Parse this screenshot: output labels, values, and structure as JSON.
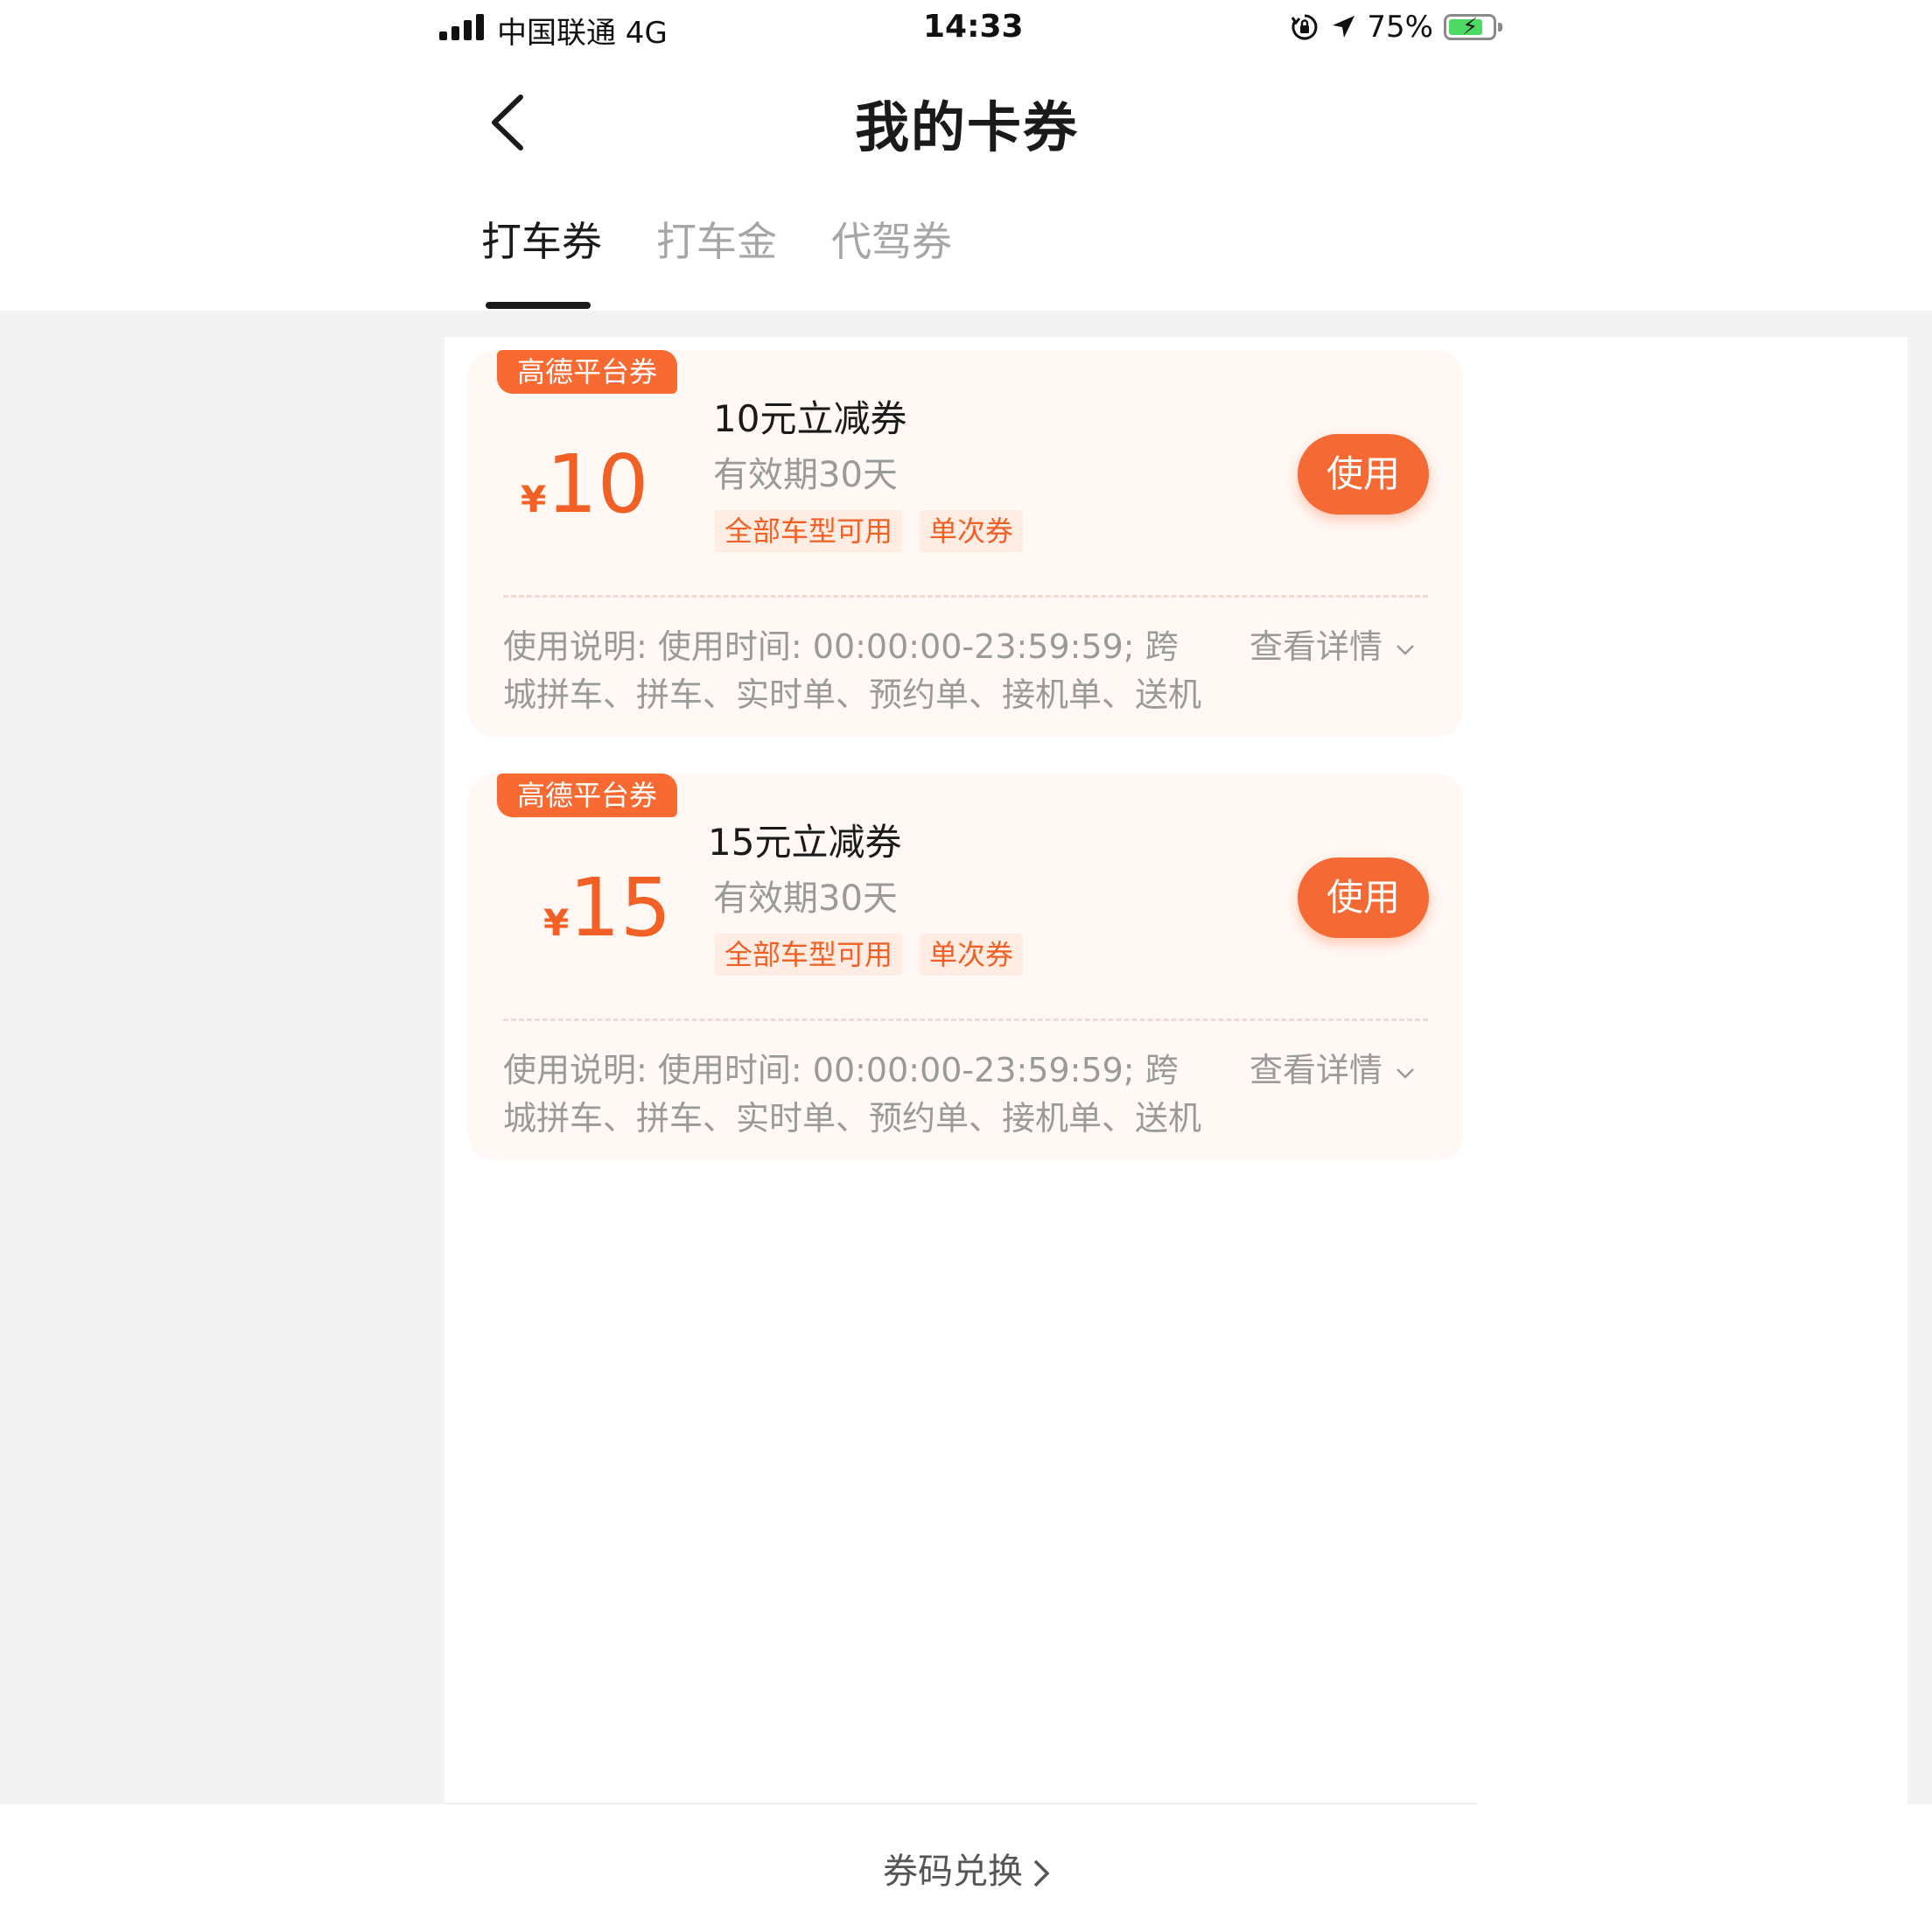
{
  "status_bar": {
    "carrier": "中国联通  4G",
    "time": "14:33",
    "battery": "75%",
    "icons": [
      "signal-icon",
      "rotation-lock-icon",
      "location-arrow-icon",
      "battery-charging-icon"
    ]
  },
  "header": {
    "title": "我的卡券",
    "back_icon": "chevron-left-icon"
  },
  "tabs": [
    {
      "label": "打车券",
      "active": true
    },
    {
      "label": "打车金",
      "active": false
    },
    {
      "label": "代驾券",
      "active": false
    }
  ],
  "coupons": [
    {
      "badge": "高德平台券",
      "currency": "¥",
      "amount": "10",
      "title": "10元立减券",
      "validity": "有效期30天",
      "tags": [
        "全部车型可用",
        "单次券"
      ],
      "use_label": "使用",
      "description": "使用说明: 使用时间: 00:00:00-23:59:59; 跨城拼车、拼车、实时单、预约单、接机单、送机",
      "details_label": "查看详情"
    },
    {
      "badge": "高德平台券",
      "currency": "¥",
      "amount": "15",
      "title": "15元立减券",
      "validity": "有效期30天",
      "tags": [
        "全部车型可用",
        "单次券"
      ],
      "use_label": "使用",
      "description": "使用说明: 使用时间: 00:00:00-23:59:59; 跨城拼车、拼车、实时单、预约单、接机单、送机",
      "details_label": "查看详情"
    }
  ],
  "footer": {
    "redeem_label": "券码兑换"
  },
  "colors": {
    "accent": "#f56a34",
    "badge": "#f96932",
    "card_bg": "#fff8f4",
    "tag_bg": "#ffece2"
  }
}
